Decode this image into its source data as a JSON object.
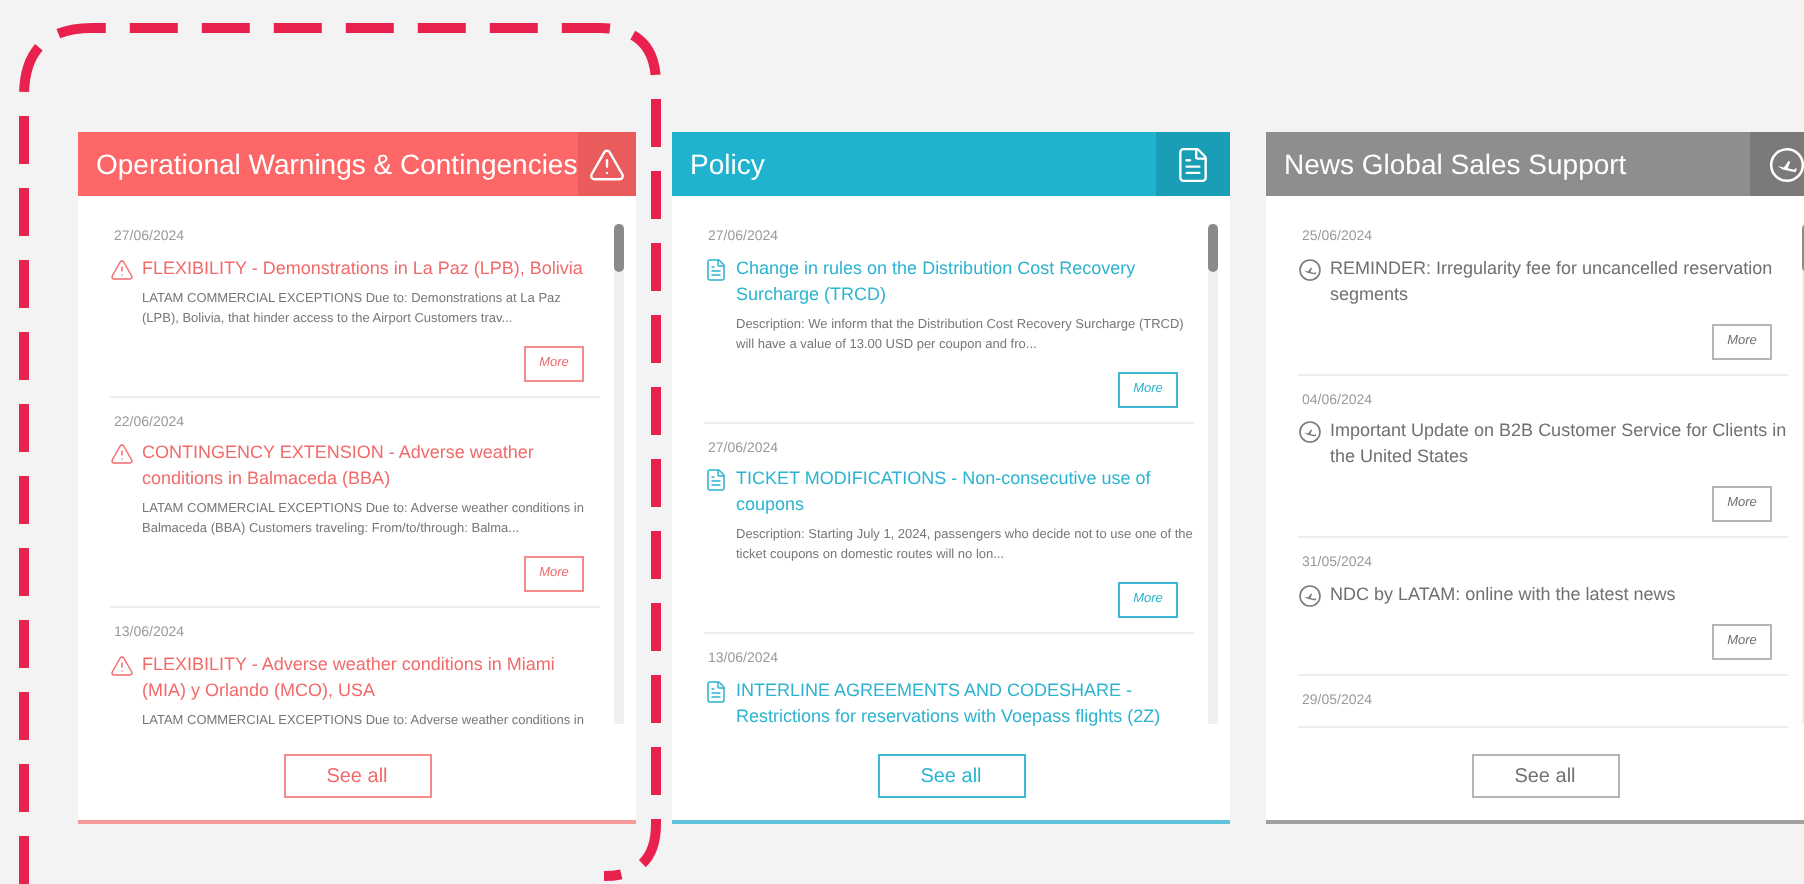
{
  "cards": [
    {
      "kind": "warning",
      "title": "Operational Warnings & Contingencies",
      "see_all": "See all",
      "items": [
        {
          "date": "27/06/2024",
          "title": "FLEXIBILITY - Demonstrations in La Paz (LPB), Bolivia",
          "description": "LATAM COMMERCIAL EXCEPTIONS Due to: Demonstrations at La Paz (LPB), Bolivia, that hinder access to the Airport Customers trav...",
          "more": "More"
        },
        {
          "date": "22/06/2024",
          "title": "CONTINGENCY EXTENSION - Adverse weather conditions in Balmaceda (BBA)",
          "description": "LATAM COMMERCIAL EXCEPTIONS Due to: Adverse weather conditions in Balmaceda (BBA) Customers traveling: From/to/through: Balma...",
          "more": "More"
        },
        {
          "date": "13/06/2024",
          "title": "FLEXIBILITY - Adverse weather conditions in Miami (MIA) y Orlando (MCO), USA",
          "description": "LATAM COMMERCIAL EXCEPTIONS Due to: Adverse weather conditions in"
        }
      ]
    },
    {
      "kind": "policy",
      "title": "Policy",
      "see_all": "See all",
      "items": [
        {
          "date": "27/06/2024",
          "title": "Change in rules on the Distribution Cost Recovery Surcharge (TRCD)",
          "description": "Description: We inform that the Distribution Cost Recovery Surcharge (TRCD) will have a value of 13.00 USD per coupon and fro...",
          "more": "More"
        },
        {
          "date": "27/06/2024",
          "title": "TICKET MODIFICATIONS - Non-consecutive use of coupons",
          "description": "Description: Starting July 1, 2024, passengers who decide not to use one of the ticket coupons on domestic routes will no lon...",
          "more": "More"
        },
        {
          "date": "13/06/2024",
          "title": "INTERLINE AGREEMENTS AND CODESHARE - Restrictions for reservations with Voepass flights (2Z)"
        }
      ]
    },
    {
      "kind": "news",
      "title": "News Global Sales Support",
      "see_all": "See all",
      "items": [
        {
          "date": "25/06/2024",
          "title": "REMINDER: Irregularity fee for uncancelled reservation segments",
          "more": "More"
        },
        {
          "date": "04/06/2024",
          "title": "Important Update on B2B Customer Service for Clients in the United States",
          "more": "More"
        },
        {
          "date": "31/05/2024",
          "title": "NDC by LATAM: online with the latest news",
          "more": "More"
        },
        {
          "date": "29/05/2024"
        }
      ]
    }
  ]
}
